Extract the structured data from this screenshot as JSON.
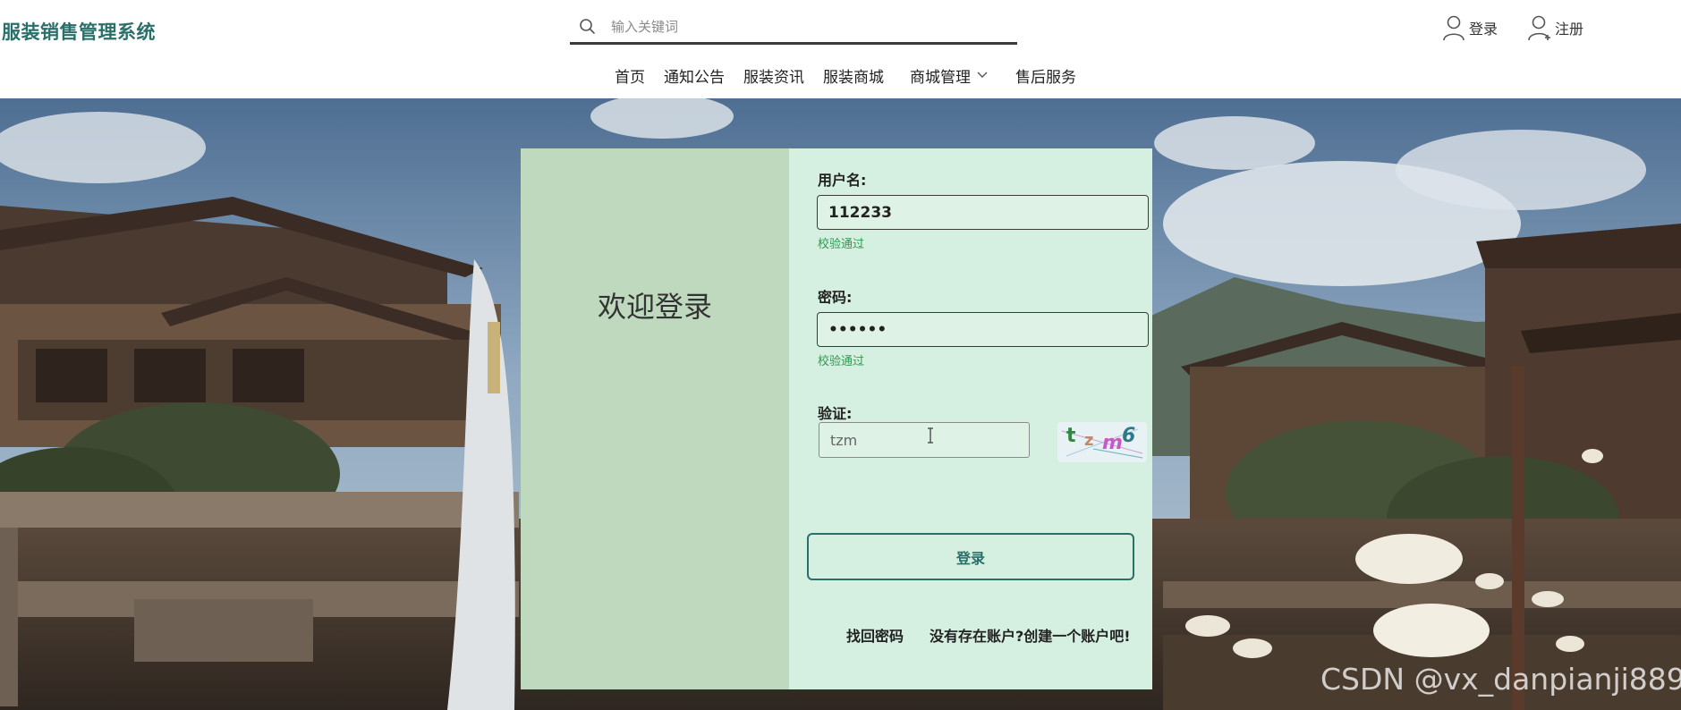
{
  "header": {
    "logo": "服装销售管理系统",
    "search_placeholder": "输入关键词",
    "login_label": "登录",
    "register_label": "注册"
  },
  "nav": {
    "items": [
      "首页",
      "通知公告",
      "服装资讯",
      "服装商城",
      "商城管理",
      "售后服务"
    ]
  },
  "login": {
    "welcome": "欢迎登录",
    "username_label": "用户名:",
    "username_value": "112233",
    "username_status": "校验通过",
    "password_label": "密码:",
    "password_value": "••••••",
    "password_status": "校验通过",
    "captcha_label": "验证:",
    "captcha_input_value": "tzm",
    "captcha_text": [
      "t",
      "z",
      "m",
      "6"
    ],
    "login_button": "登录",
    "forgot_password": "找回密码",
    "create_account": "没有存在账户?创建一个账户吧!"
  },
  "watermark": "CSDN @vx_danpianji889",
  "colors": {
    "accent": "#2a6f6a",
    "card_left": "#bfd9be",
    "card_right": "#d5efe1",
    "valid": "#2f9a4e"
  }
}
